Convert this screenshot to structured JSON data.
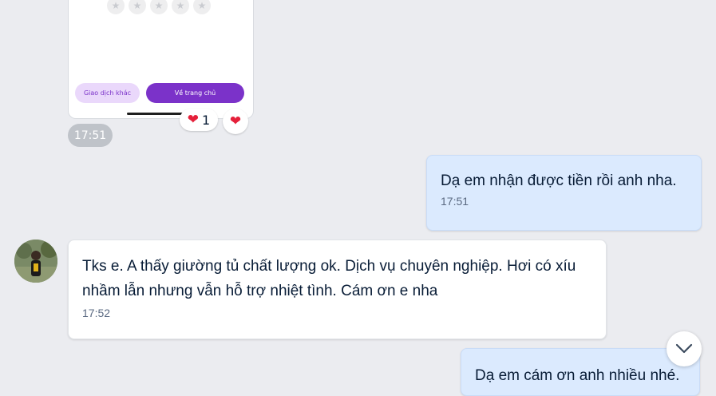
{
  "colors": {
    "background": "#ebecf0",
    "my_bubble": "#dbeafe",
    "their_bubble": "#ffffff",
    "receipt_accent": "#7b32c9",
    "heart": "#e5203a"
  },
  "image_message": {
    "rating_star_count": 5,
    "secondary_button_label": "Giao dịch khác",
    "primary_button_label": "Về trang chủ",
    "reaction_icon": "heart-icon",
    "reaction_count": "1",
    "time": "17:51"
  },
  "messages": [
    {
      "sender": "me",
      "text": "Dạ em nhận được tiền rồi anh nha.",
      "time": "17:51"
    },
    {
      "sender": "contact",
      "text": "Tks e. A thấy giường tủ chất lượng ok. Dịch vụ chuyên nghiệp. Hơi có xíu nhầm lẫn nhưng vẫn hỗ trợ nhiệt tình. Cám ơn e nha",
      "time": "17:52"
    },
    {
      "sender": "me",
      "text": "Dạ em cám ơn anh nhiều nhé.",
      "time": ""
    }
  ],
  "scroll_button_icon": "chevron-down-icon"
}
